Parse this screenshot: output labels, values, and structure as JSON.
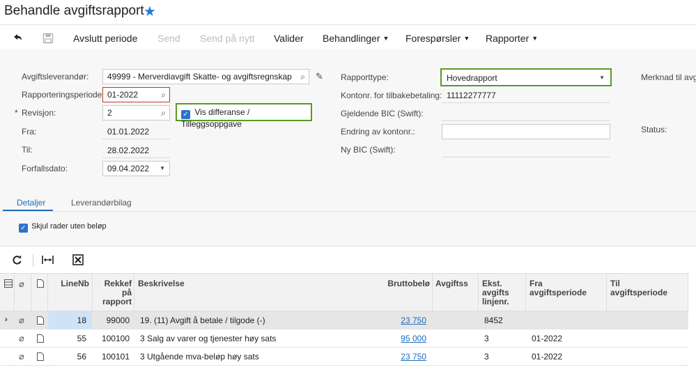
{
  "page": {
    "title": "Behandle avgiftsrapport"
  },
  "toolbar": {
    "undo_icon": "undo-icon",
    "save_icon": "save-icon",
    "close_period": "Avslutt periode",
    "send": "Send",
    "resend": "Send på nytt",
    "validate": "Valider",
    "processing": "Behandlinger",
    "inquiries": "Forespørsler",
    "reports": "Rapporter"
  },
  "form": {
    "vendor_label": "Avgiftsleverandør:",
    "vendor_value": "49999 - Merverdiavgift Skatte- og avgiftsregnskap",
    "period_label": "Rapporteringsperiode:",
    "period_value": "01-2022",
    "revision_star": "*",
    "revision_label": "Revisjon:",
    "revision_value": "2",
    "show_diff_label": "Vis differanse / Tilleggsoppgave",
    "from_label": "Fra:",
    "from_value": "01.01.2022",
    "to_label": "Til:",
    "to_value": "28.02.2022",
    "due_label": "Forfallsdato:",
    "due_value": "09.04.2022",
    "report_type_label": "Rapporttype:",
    "report_type_value": "Hovedrapport",
    "account_refund_label": "Kontonr. for tilbakebetaling:",
    "account_refund_value": "11112277777",
    "current_bic_label": "Gjeldende BIC (Swift):",
    "change_account_label": "Endring av kontonr.:",
    "new_bic_label": "Ny BIC (Swift):",
    "note_label": "Merknad til avg",
    "status_label": "Status:"
  },
  "tabs": [
    {
      "label": "Detaljer"
    },
    {
      "label": "Leverandørbilag"
    }
  ],
  "details": {
    "hide_zero_label": "Skjul rader uten beløp"
  },
  "grid": {
    "headers": {
      "line_nbr": "LineNb",
      "sort_1": "Rekkef",
      "sort_2": "på",
      "sort_3": "rapport",
      "description": "Beskrivelse",
      "gross": "Bruttobelø",
      "tax_rate": "Avgiftss",
      "ext_1": "Ekst.",
      "ext_2": "avgifts",
      "ext_3": "linjenr.",
      "from_1": "Fra",
      "from_2": "avgiftsperiode",
      "to_1": "Til",
      "to_2": "avgiftsperiode"
    },
    "rows": [
      {
        "line": "18",
        "sort": "99000",
        "desc": "19. (11) Avgift å betale / tilgode (-)",
        "gross": "23 750",
        "ext": "8452",
        "from": ""
      },
      {
        "line": "55",
        "sort": "100100",
        "desc": "3 Salg av varer og tjenester høy sats",
        "gross": "95 000",
        "ext": "3",
        "from": "01-2022"
      },
      {
        "line": "56",
        "sort": "100101",
        "desc": "3 Utgående mva-beløp høy sats",
        "gross": "23 750",
        "ext": "3",
        "from": "01-2022"
      }
    ]
  }
}
